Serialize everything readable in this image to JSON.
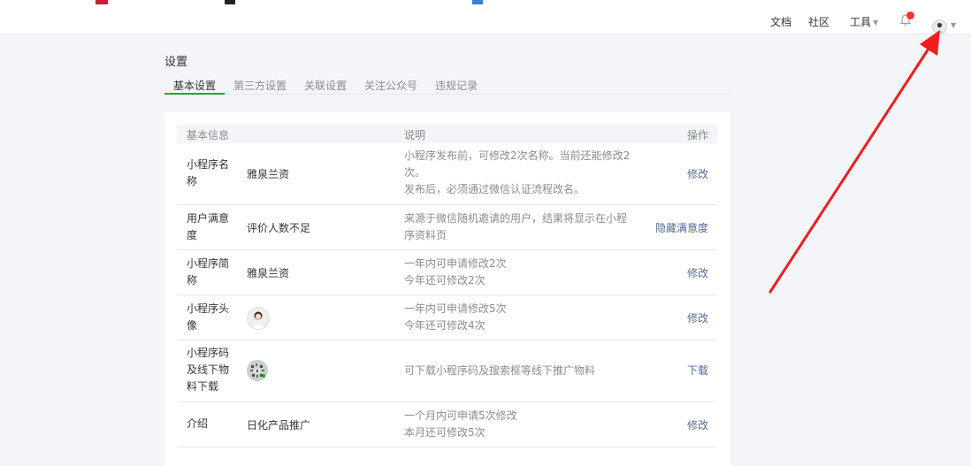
{
  "header": {
    "nav_docs": "文档",
    "nav_community": "社区",
    "nav_tools": "工具",
    "notification_icon": "bell-icon",
    "avatar_icon": "user-avatar",
    "dropdown_icon": "chevron-down-icon"
  },
  "page": {
    "title": "设置",
    "tabs": [
      {
        "label": "基本设置",
        "active": true
      },
      {
        "label": "第三方设置",
        "active": false
      },
      {
        "label": "关联设置",
        "active": false
      },
      {
        "label": "关注公众号",
        "active": false
      },
      {
        "label": "违规记录",
        "active": false
      }
    ]
  },
  "table": {
    "headers": {
      "info": "基本信息",
      "desc": "说明",
      "action": "操作"
    },
    "rows": [
      {
        "label": "小程序名称",
        "value": "雅泉兰资",
        "desc": [
          "小程序发布前，可修改2次名称。当前还能修改2次。",
          "发布后，必须通过微信认证流程改名。"
        ],
        "action": "修改"
      },
      {
        "label": "用户满意度",
        "value": "评价人数不足",
        "desc": [
          "来源于微信随机邀请的用户，结果将显示在小程序资料页"
        ],
        "action": "隐藏满意度"
      },
      {
        "label": "小程序简称",
        "value": "雅泉兰资",
        "desc": [
          "一年内可申请修改2次",
          "今年还可修改2次"
        ],
        "action": "修改"
      },
      {
        "label": "小程序头像",
        "value_icon": "avatar-image",
        "desc": [
          "一年内可申请修改5次",
          "今年还可修改4次"
        ],
        "action": "修改"
      },
      {
        "label": "小程序码及线下物料下载",
        "value_icon": "qr-code-image",
        "desc": [
          "可下载小程序码及搜索框等线下推广物料"
        ],
        "action": "下载"
      },
      {
        "label": "介绍",
        "value": "日化产品推广",
        "desc": [
          "一个月内可申请5次修改",
          "本月还可修改5次"
        ],
        "action": "修改"
      }
    ]
  },
  "colors": {
    "accent": "#1aad19",
    "link": "#576b95",
    "annotation_arrow": "#f21c1c",
    "badge": "#f43530"
  }
}
